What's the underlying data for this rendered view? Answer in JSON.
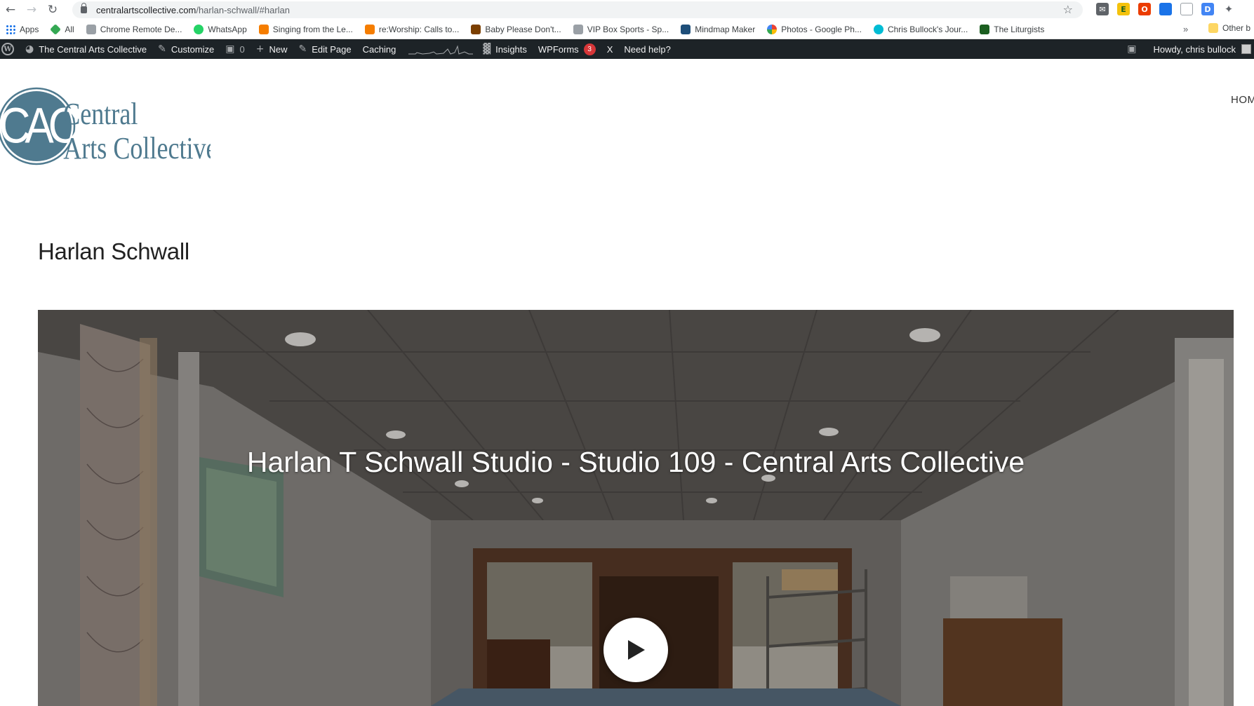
{
  "browser": {
    "url_domain": "centralartscollective.com",
    "url_path": "/harlan-schwall/#harlan"
  },
  "bookmarks": [
    {
      "label": "Apps",
      "color": "#1a73e8"
    },
    {
      "label": "All",
      "color": "#34a853"
    },
    {
      "label": "Chrome Remote De...",
      "color": "#9aa0a6"
    },
    {
      "label": "WhatsApp",
      "color": "#25d366"
    },
    {
      "label": "Singing from the Le...",
      "color": "#f57d00"
    },
    {
      "label": "re:Worship: Calls to...",
      "color": "#f57d00"
    },
    {
      "label": "Baby Please Don't...",
      "color": "#7b3f00"
    },
    {
      "label": "VIP Box Sports - Sp...",
      "color": "#9aa0a6"
    },
    {
      "label": "Mindmap Maker",
      "color": "#1e4e79"
    },
    {
      "label": "Photos - Google Ph...",
      "color": "#ea4335"
    },
    {
      "label": "Chris Bullock's Jour...",
      "color": "#00bcd4"
    },
    {
      "label": "The Liturgists",
      "color": "#1b5e20"
    }
  ],
  "bookmarks_more": "»",
  "bookmarks_other": "Other b",
  "wp_admin": {
    "site_name": "The Central Arts Collective",
    "customize": "Customize",
    "comments_count": "0",
    "new": "New",
    "edit_page": "Edit Page",
    "caching": "Caching",
    "insights": "Insights",
    "wpforms": "WPForms",
    "wpforms_badge": "3",
    "x": "X",
    "need_help": "Need help?",
    "howdy": "Howdy, chris bullock"
  },
  "site": {
    "logo_initials": "CAC",
    "logo_line1": "Central",
    "logo_line2": "Arts Collective",
    "nav_home": "HOM"
  },
  "page": {
    "title": "Harlan Schwall"
  },
  "video": {
    "title": "Harlan T Schwall Studio - Studio 109 - Central Arts Collective"
  },
  "colors": {
    "wp_bar": "#1d2327",
    "logo_blue": "#4f7a8f",
    "badge_red": "#d63638"
  }
}
